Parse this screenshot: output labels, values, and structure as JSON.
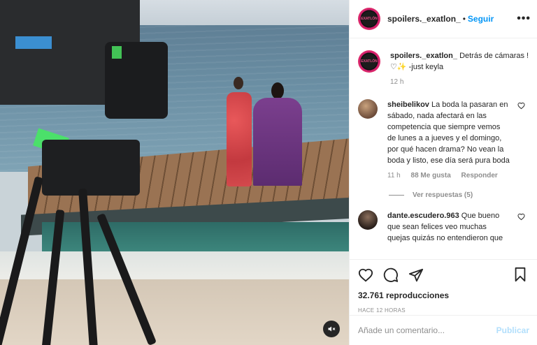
{
  "post": {
    "username": "spoilers._exatlon_",
    "follow_label": "Seguir",
    "separator": "•",
    "more_label": "•••",
    "avatar_text": "EXATLÓN"
  },
  "caption": {
    "username": "spoilers._exatlon_",
    "text": "Detrás de cámaras ! ♡✨ -just keyla",
    "time": "12 h"
  },
  "comments": [
    {
      "username": "sheibelikov",
      "text": "La boda la pasaran en sábado, nada afectará en las competencia que siempre vemos de lunes a a jueves y el domingo, por qué hacen drama? No vean la boda y listo, ese día será pura boda",
      "time": "11 h",
      "likes": "88 Me gusta",
      "reply": "Responder",
      "view_replies": "Ver respuestas (5)"
    },
    {
      "username": "dante.escudero.963",
      "text": "Que bueno que sean felices veo muchas quejas quizás no entendieron que"
    }
  ],
  "stats": {
    "views": "32.761 reproducciones",
    "posted": "HACE 12 HORAS"
  },
  "composer": {
    "placeholder": "Añade un comentario...",
    "publish_label": "Publicar"
  },
  "icons": {
    "like": "heart-icon",
    "comment": "comment-icon",
    "share": "share-icon",
    "save": "bookmark-icon",
    "mute": "muted-speaker-icon",
    "comment_like": "heart-icon"
  },
  "colors": {
    "link": "#0095f6",
    "publish_disabled": "#b2dffc",
    "muted_text": "#8e8e8e",
    "text": "#262626"
  }
}
